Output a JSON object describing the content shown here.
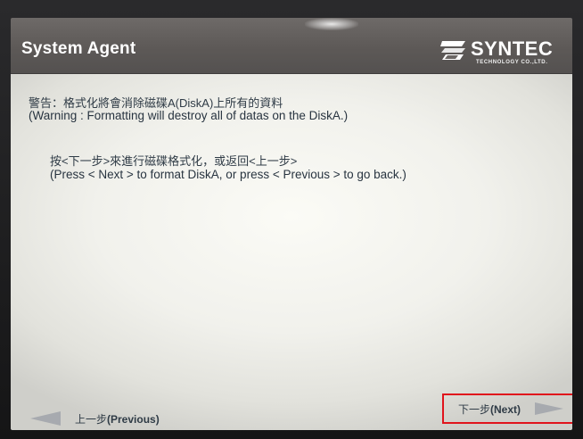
{
  "header": {
    "title": "System Agent",
    "logo_name": "SYNTEC",
    "logo_sub": "TECHNOLOGY CO.,LTD."
  },
  "content": {
    "warning_zh": "警告：格式化將會消除磁碟A(DiskA)上所有的資料",
    "warning_en": "(Warning : Formatting will destroy all of datas on the DiskA.)",
    "instruction_zh": "按<下一步>來進行磁碟格式化，或返回<上一步>",
    "instruction_en": "(Press < Next > to format DiskA, or press < Previous > to go back.)"
  },
  "nav": {
    "previous_zh": "上一步",
    "previous_en": "(Previous)",
    "next_zh": "下一步",
    "next_en": "(Next)"
  },
  "icons": {
    "previous": "arrow-left-icon",
    "next": "arrow-right-icon",
    "logo": "syntec-logo-icon"
  },
  "colors": {
    "header": "#5d5957",
    "text": "#2f3b46",
    "arrow": "#a7aaaf",
    "highlight": "#e0141c"
  }
}
